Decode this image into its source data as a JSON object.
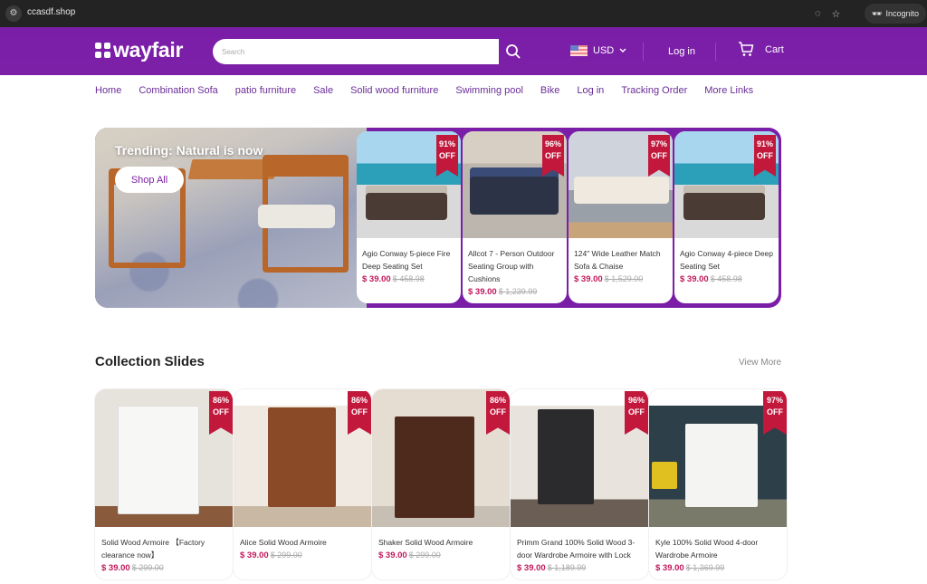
{
  "browser": {
    "url": "ccasdf.shop",
    "incognito_label": "Incognito"
  },
  "header": {
    "logo_text": "wayfair",
    "search_placeholder": "Search",
    "currency": "USD",
    "login": "Log in",
    "cart": "Cart"
  },
  "nav": [
    "Home",
    "Combination Sofa",
    "patio furniture",
    "Sale",
    "Solid wood furniture",
    "Swimming pool",
    "Bike",
    "Log in",
    "Tracking Order",
    "More Links"
  ],
  "hero": {
    "title": "Trending: Natural is now",
    "button": "Shop All",
    "products": [
      {
        "title": "Agio Conway 5-piece Fire Deep Seating Set",
        "price": "$ 39.00",
        "old_price": "$ 458.98",
        "discount": [
          "91%",
          "OFF"
        ]
      },
      {
        "title": "Allcot 7 - Person Outdoor Seating Group with Cushions",
        "price": "$ 39.00",
        "old_price": "$ 1,239.99",
        "discount": [
          "96%",
          "OFF"
        ]
      },
      {
        "title": "124\" Wide Leather Match Sofa & Chaise",
        "price": "$ 39.00",
        "old_price": "$ 1,529.00",
        "discount": [
          "97%",
          "OFF"
        ]
      },
      {
        "title": "Agio Conway 4-piece Deep Seating Set",
        "price": "$ 39.00",
        "old_price": "$ 458.98",
        "discount": [
          "91%",
          "OFF"
        ]
      }
    ]
  },
  "collection": {
    "title": "Collection Slides",
    "view_more": "View More",
    "products": [
      {
        "title": "Solid Wood Armoire 【Factory clearance now】",
        "price": "$ 39.00",
        "old_price": "$ 299.00",
        "discount": [
          "86%",
          "OFF"
        ]
      },
      {
        "title": "Alice Solid Wood Armoire",
        "price": "$ 39.00",
        "old_price": "$ 299.00",
        "discount": [
          "86%",
          "OFF"
        ]
      },
      {
        "title": "Shaker Solid Wood Armoire",
        "price": "$ 39.00",
        "old_price": "$ 299.00",
        "discount": [
          "86%",
          "OFF"
        ]
      },
      {
        "title": "Primm Grand 100% Solid Wood 3-door Wardrobe Armoire with Lock",
        "price": "$ 39.00",
        "old_price": "$ 1,189.99",
        "discount": [
          "96%",
          "OFF"
        ]
      },
      {
        "title": "Kyle 100% Solid Wood 4-door Wardrobe Armoire",
        "price": "$ 39.00",
        "old_price": "$ 1,369.99",
        "discount": [
          "97%",
          "OFF"
        ]
      }
    ]
  },
  "colors": {
    "brand_purple": "#7b1fa2",
    "price_red": "#c2185b",
    "ribbon_red": "#c2183c"
  }
}
